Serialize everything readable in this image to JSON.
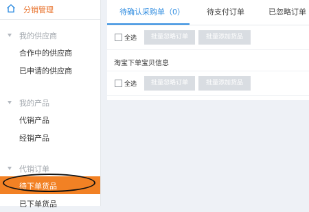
{
  "sidebar": {
    "title": "分销管理",
    "groups": [
      {
        "label": "我的供应商",
        "items": [
          {
            "label": "合作中的供应商"
          },
          {
            "label": "已申请的供应商"
          }
        ]
      },
      {
        "label": "我的产品",
        "items": [
          {
            "label": "代销产品"
          },
          {
            "label": "经销产品"
          }
        ]
      },
      {
        "label": "代销订单",
        "items": [
          {
            "label": "待下单货品",
            "active": true
          },
          {
            "label": "已下单货品"
          }
        ]
      }
    ]
  },
  "tabs": [
    {
      "label": "待确认采购单（0）",
      "active": true
    },
    {
      "label": "待支付订单"
    },
    {
      "label": "已忽略订单（"
    }
  ],
  "toolbar": {
    "select_all": "全选",
    "batch_ignore": "批量忽略订单",
    "batch_add": "批量添加货品"
  },
  "info_row": {
    "text": "淘宝下单宝贝信息"
  },
  "colors": {
    "accent_orange": "#f28124",
    "accent_blue": "#2f8ce0",
    "disabled_button": "#d9dde2"
  }
}
